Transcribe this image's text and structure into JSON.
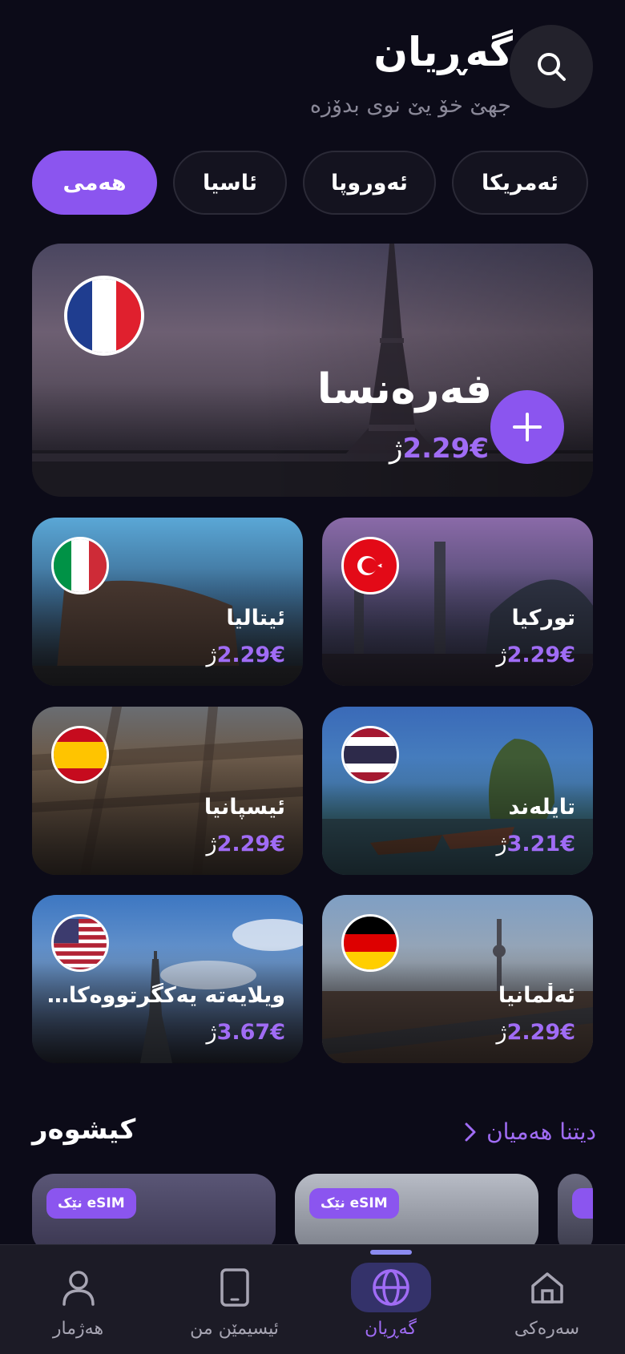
{
  "header": {
    "title": "گەڕیان",
    "subtitle": "جهێ خۆ یێ نوی بدۆزە",
    "search_icon": "search-icon"
  },
  "filters": [
    {
      "label": "ئەمریکا",
      "active": false
    },
    {
      "label": "ئەوروپا",
      "active": false
    },
    {
      "label": "ئاسیا",
      "active": false
    },
    {
      "label": "هەمی",
      "active": true
    }
  ],
  "featured": {
    "name": "فەرەنسا",
    "price_prefix": "ژ",
    "price": "2.29€",
    "flag": "france-flag",
    "action_icon": "plus-icon"
  },
  "destinations": [
    {
      "name": "تورکیا",
      "price_prefix": "ژ",
      "price": "2.29€",
      "flag": "turkey-flag"
    },
    {
      "name": "ئیتالیا",
      "price_prefix": "ژ",
      "price": "2.29€",
      "flag": "italy-flag"
    },
    {
      "name": "تایلەند",
      "price_prefix": "ژ",
      "price": "3.21€",
      "flag": "thailand-flag"
    },
    {
      "name": "ئیسپانیا",
      "price_prefix": "ژ",
      "price": "2.29€",
      "flag": "spain-flag"
    },
    {
      "name": "ئەڵمانیا",
      "price_prefix": "ژ",
      "price": "2.29€",
      "flag": "germany-flag"
    },
    {
      "name": "ویلایەتە یەکگرتووەکانی ئەمریکا",
      "price_prefix": "ژ",
      "price": "3.67€",
      "flag": "usa-flag"
    }
  ],
  "offers_section": {
    "title": "کیشوەر",
    "see_all": "دیتنا هەمیان",
    "badges": [
      "eSIM نێک",
      "eSIM نێک"
    ]
  },
  "bottom_nav": [
    {
      "label": "سەرەکی",
      "icon": "home-icon",
      "active": false
    },
    {
      "label": "گەڕیان",
      "icon": "globe-icon",
      "active": true
    },
    {
      "label": "ئیسیمێن من",
      "icon": "phone-icon",
      "active": false
    },
    {
      "label": "هەژمار",
      "icon": "user-icon",
      "active": false
    }
  ],
  "colors": {
    "background": "#0c0b18",
    "accent": "#8b55ef",
    "price": "#a06cf5",
    "nav_bg": "#1c1b26"
  }
}
